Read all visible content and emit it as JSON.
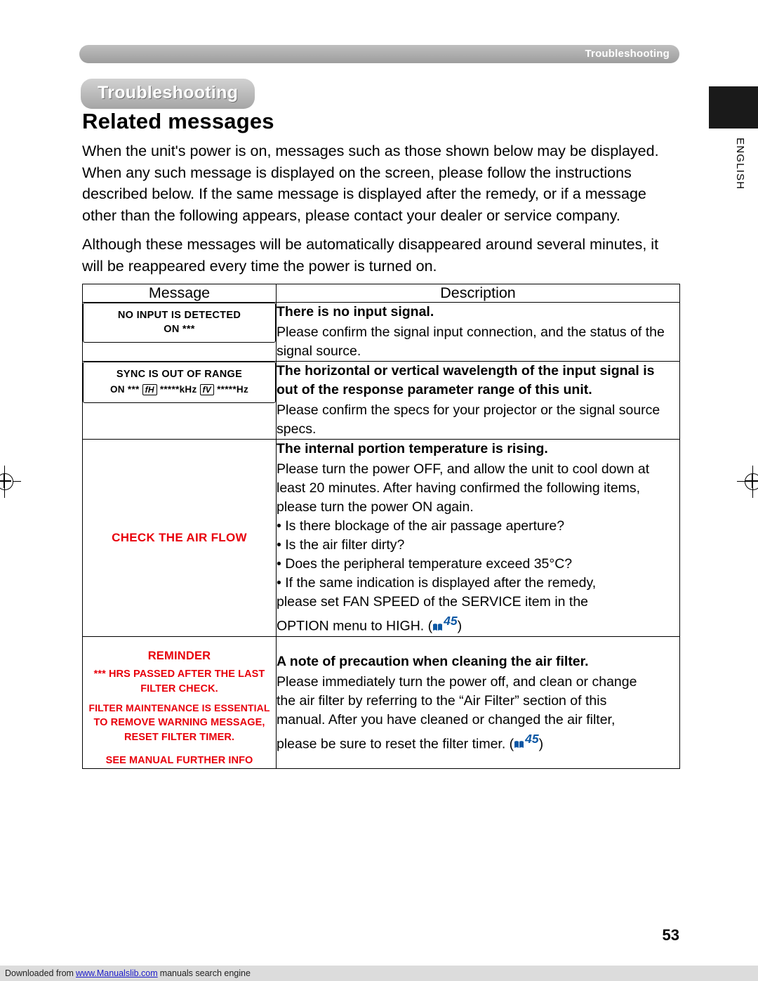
{
  "header": {
    "running_head": "Troubleshooting",
    "chapter": "Troubleshooting",
    "section_title": "Related messages",
    "language_tab": "ENGLISH"
  },
  "intro": {
    "paragraph1": "When the unit's power is on, messages such as those shown below may be displayed. When any such message is displayed on the screen, please follow the instructions described below. If the same message is displayed after the remedy, or if a message other than the following appears, please contact your dealer or service company.",
    "paragraph2": "Although these messages will be automatically disappeared around several minutes, it will be reappeared every time the power is turned on."
  },
  "table": {
    "headers": {
      "message": "Message",
      "description": "Description"
    },
    "rows": [
      {
        "osd": {
          "line1": "NO INPUT IS DETECTED",
          "line2": "ON ***"
        },
        "desc_head": "There is no input signal.",
        "desc_body": "Please confirm the signal input connection, and the status of the signal source."
      },
      {
        "osd": {
          "line1": "SYNC IS OUT OF RANGE",
          "line2_prefix": "ON ***",
          "glyph_h": "fH",
          "value_h": "*****kHz",
          "glyph_v": "fV",
          "value_v": "*****Hz"
        },
        "desc_head": "The horizontal or vertical wavelength of the input signal is out of the response parameter range of this unit.",
        "desc_body": "Please confirm the specs for your projector or the signal source specs."
      },
      {
        "osd_label": "CHECK THE AIR FLOW",
        "desc_head": "The internal portion temperature is rising.",
        "desc_body": "Please turn the power OFF, and allow the unit to cool down at least 20 minutes. After having confirmed the following items, please turn the power ON again.",
        "bullets": [
          "• Is there blockage of the air passage aperture?",
          "• Is the air filter dirty?",
          "• Does the peripheral temperature exceed 35°C?",
          "• If the same indication is displayed after the remedy,"
        ],
        "desc_tail_line1": "please set FAN SPEED of the SERVICE item in the",
        "desc_tail_line2": "OPTION menu to HIGH. (",
        "page_ref": "45",
        "desc_tail_line3": ")"
      },
      {
        "osd_lines": [
          "REMINDER",
          "***  HRS PASSED AFTER THE LAST",
          "FILTER CHECK.",
          "FILTER MAINTENANCE IS ESSENTIAL",
          "TO REMOVE WARNING MESSAGE,",
          "RESET FILTER TIMER.",
          "SEE MANUAL FURTHER INFO"
        ],
        "desc_head": "A note of precaution when cleaning the air filter.",
        "desc_body_line1": "Please immediately turn the power off, and clean or change",
        "desc_body_line2": "the air filter by referring to the “Air Filter” section of this",
        "desc_body_line3": "manual. After you have cleaned or changed the air filter,",
        "desc_body_line4": "please be sure to reset the filter timer. (",
        "page_ref": "45",
        "desc_body_line5": ")"
      }
    ]
  },
  "footer": {
    "page_number": "53",
    "download_prefix": "Downloaded from",
    "download_link": "www.Manualslib.com",
    "download_suffix": "manuals search engine"
  }
}
